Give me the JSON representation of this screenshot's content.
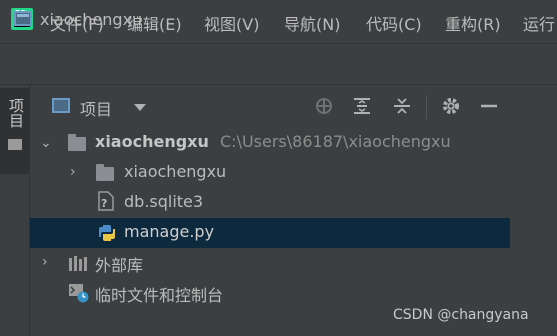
{
  "menu": {
    "items": [
      "文件(F)",
      "编辑(E)",
      "视图(V)",
      "导航(N)",
      "代码(C)",
      "重构(R)",
      "运行"
    ]
  },
  "navbar": {
    "project_label": "xiaochengxu"
  },
  "side_stripe": {
    "tab_label": "项目"
  },
  "project_panel": {
    "title": "项目",
    "tree": {
      "root_name": "xiaochengxu",
      "root_path": "C:\\Users\\86187\\xiaochengxu",
      "subfolder": "xiaochengxu",
      "file_db": "db.sqlite3",
      "file_manage": "manage.py",
      "external_libs": "外部库",
      "scratches": "临时文件和控制台"
    }
  },
  "watermark": "CSDN @changyana",
  "colors": {
    "selection": "#0d293e",
    "background": "#3c3f41",
    "text": "#bbbbbb",
    "path_text": "#8c8c8c"
  }
}
